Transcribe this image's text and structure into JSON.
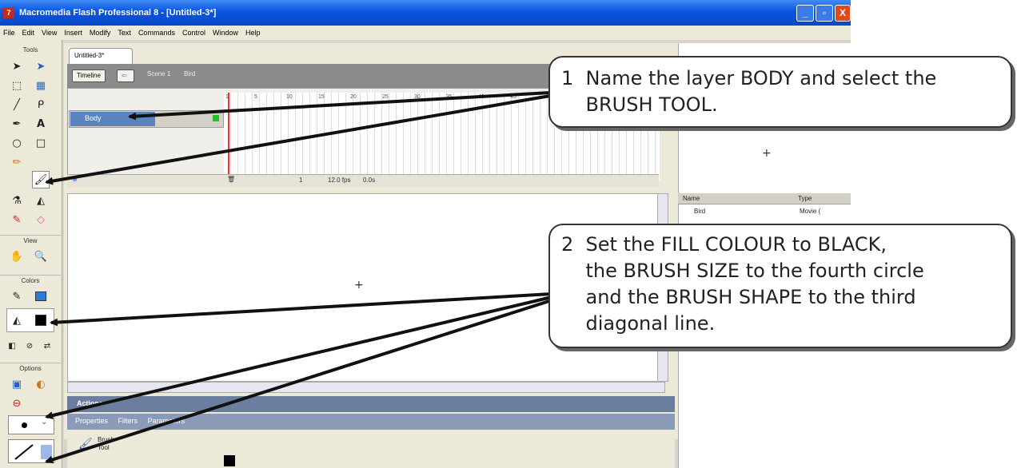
{
  "window": {
    "title": "Macromedia Flash Professional 8 - [Untitled-3*]",
    "app_icon": "7",
    "min": "_",
    "max": "▫",
    "close": "X"
  },
  "menu": [
    "File",
    "Edit",
    "View",
    "Insert",
    "Modify",
    "Text",
    "Commands",
    "Control",
    "Window",
    "Help"
  ],
  "tools": {
    "header": "Tools",
    "view_header": "View",
    "colors_header": "Colors",
    "options_header": "Options"
  },
  "document": {
    "tab": "Untitled-3*",
    "timeline_button": "Timeline",
    "scene": "Scene 1",
    "symbol": "Bird"
  },
  "timeline": {
    "layer_name": "Body",
    "frame_numbers": [
      "1",
      "5",
      "10",
      "15",
      "20",
      "25",
      "30",
      "35",
      "40",
      "45"
    ],
    "current_frame": "1",
    "fps": "12.0 fps",
    "time": "0.0s"
  },
  "library": {
    "col_name": "Name",
    "col_type": "Type",
    "item_name": "Bird",
    "item_type": "Movie ("
  },
  "panels": {
    "actions": "Actions",
    "tab_properties": "Properties",
    "tab_filters": "Filters",
    "tab_parameters": "Parameters",
    "tool_name_1": "Brush",
    "tool_name_2": "Tool"
  },
  "callouts": {
    "step1": {
      "line1": "1  Name the layer BODY and select the",
      "line2": "    BRUSH TOOL."
    },
    "step2": {
      "line1": "2  Set the FILL COLOUR to BLACK,",
      "line2": "    the BRUSH SIZE to the fourth circle",
      "line3": "    and the BRUSH SHAPE to the third",
      "line4": "    diagonal line."
    }
  },
  "colors": {
    "fill": "#000000",
    "accent": "#0a55e0"
  }
}
